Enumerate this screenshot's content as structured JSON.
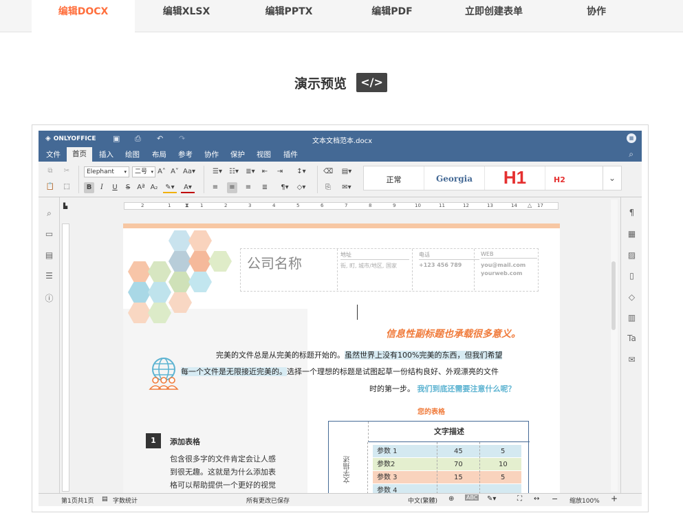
{
  "nav": {
    "tabs": [
      {
        "label": "编辑DOCX",
        "active": true
      },
      {
        "label": "编辑XLSX"
      },
      {
        "label": "编辑PPTX"
      },
      {
        "label": "编辑PDF"
      },
      {
        "label": "立即创建表单"
      },
      {
        "label": "协作"
      }
    ]
  },
  "demo": {
    "title": "演示预览",
    "code_label": "</>"
  },
  "editor": {
    "logo": "ONLYOFFICE",
    "doc_title": "文本文档范本.docx",
    "menu": [
      "文件",
      "首页",
      "插入",
      "绘图",
      "布局",
      "参考",
      "协作",
      "保护",
      "视图",
      "插件"
    ],
    "font_name": "Elephant",
    "font_size": "二号",
    "styles": [
      "正常",
      "Georgia",
      "H1",
      "H2"
    ],
    "accent": "#446995"
  },
  "doc": {
    "company": "公司名称",
    "address_label": "地址",
    "address_value": "街, 町, 城市/地区, 国家",
    "phone_label": "电话",
    "phone_value": "+123 456 789",
    "web_label": "WEB",
    "web_value1": "you@mail.com",
    "web_value2": "yourweb.com",
    "subtitle": "信息性副标题也承载很多意义。",
    "para1a": "完美的文件总是从完美的标题开始的。",
    "para1b": "虽然世界上没有100%完美的东西，但我们希望",
    "para2a": "每一个文件是无限接近完美的。",
    "para2b": "选择一个理想的标题是试图起草一份结构良好、外观漂亮的文件",
    "para3": "时的第一步。",
    "question": "我们到底还需要注意什么呢？",
    "table_title": "您的表格",
    "table_header": "文字描述",
    "table_side": "文字描述",
    "rows": [
      {
        "name": "参数 1",
        "a": "45",
        "b": "5",
        "color": "#d4e9f1"
      },
      {
        "name": "参数2",
        "a": "70",
        "b": "10",
        "color": "#e4efcf"
      },
      {
        "name": "参数 3",
        "a": "15",
        "b": "5",
        "color": "#f9d3bd"
      },
      {
        "name": "参数 4",
        "a": "",
        "b": "",
        "color": "#d4e9f1"
      }
    ],
    "section_num": "1",
    "section_title": "添加表格",
    "section_lines": [
      "包含很多字的文件肯定会让人感",
      "到很无趣。这就是为什么添加表",
      "格可以帮助提供一个更好的视觉"
    ]
  },
  "status": {
    "page": "第1页共1页",
    "word_count": "字数统计",
    "saved": "所有更改已保存",
    "language": "中文(繁體)",
    "zoom": "缩放100%"
  }
}
